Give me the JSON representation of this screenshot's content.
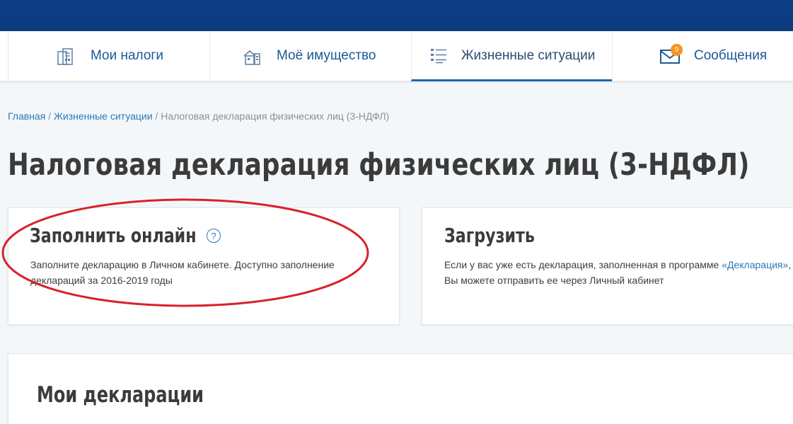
{
  "nav": {
    "items": [
      {
        "label": "Мои налоги",
        "icon": "tax-documents-icon"
      },
      {
        "label": "Моё имущество",
        "icon": "property-icon"
      },
      {
        "label": "Жизненные ситуации",
        "icon": "list-icon",
        "active": true
      },
      {
        "label": "Сообщения",
        "icon": "envelope-icon",
        "badge": "9"
      }
    ]
  },
  "breadcrumb": {
    "home": "Главная",
    "sep1": " / ",
    "section": "Жизненные ситуации",
    "sep2": " / ",
    "current": "Налоговая декларация физических лиц (3-НДФЛ)"
  },
  "page": {
    "title": "Налоговая декларация физических лиц (3-НДФЛ)"
  },
  "cards": {
    "fill_online": {
      "title": "Заполнить онлайн",
      "text": "Заполните декларацию в Личном кабинете. Доступно заполнение деклараций за 2016-2019 годы",
      "help": "?"
    },
    "upload": {
      "title": "Загрузить",
      "text_before": "Если у вас уже есть декларация, заполненная в программе ",
      "link": "«Декларация»",
      "text_after": ", Вы можете отправить ее через Личный кабинет"
    }
  },
  "declarations": {
    "title": "Мои декларации"
  },
  "colors": {
    "header_blue": "#0e3f86",
    "link_blue": "#2a78b8",
    "active_underline": "#1f67b2",
    "badge_orange": "#f7941d",
    "annotation_red": "#d8212b"
  }
}
